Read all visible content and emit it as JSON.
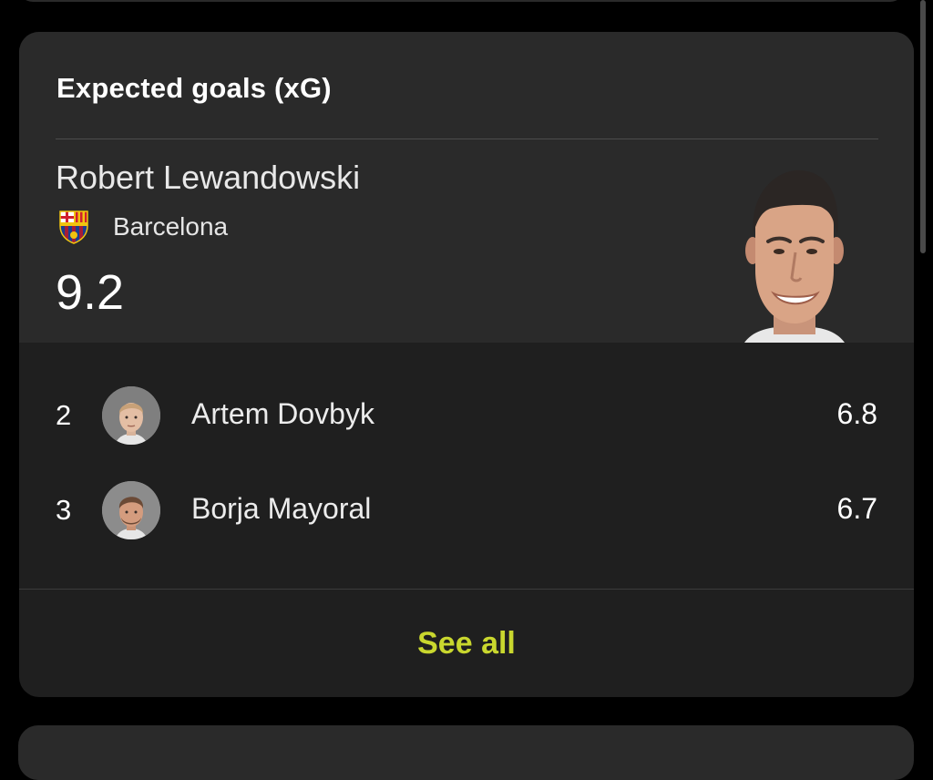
{
  "card": {
    "title": "Expected goals (xG)",
    "leader": {
      "name": "Robert Lewandowski",
      "club": "Barcelona",
      "club_icon": "barcelona-crest-icon",
      "value": "9.2"
    },
    "rows": [
      {
        "rank": "2",
        "name": "Artem Dovbyk",
        "value": "6.8"
      },
      {
        "rank": "3",
        "name": "Borja Mayoral",
        "value": "6.7"
      }
    ],
    "see_all_label": "See all"
  },
  "colors": {
    "accent": "#c9d72e",
    "card_bg": "#1f1f1f",
    "header_bg": "#2a2a2a",
    "page_bg": "#000000"
  }
}
